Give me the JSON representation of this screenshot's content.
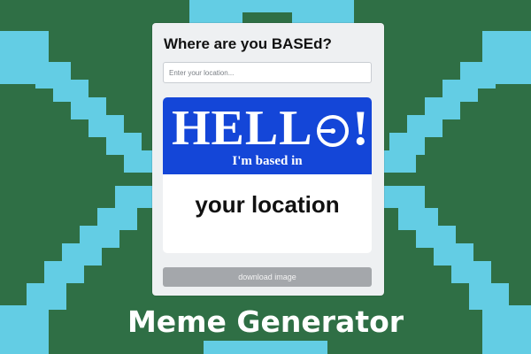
{
  "colors": {
    "background": "#2f6f45",
    "pixel_pattern": "#63cde4",
    "badge_blue": "#1446d8",
    "button_gray": "#a4a7ab"
  },
  "card": {
    "title": "Where are you BASEd?",
    "location_input": {
      "value": "",
      "placeholder": "Enter your location..."
    },
    "badge": {
      "hello_text": "HELL",
      "exclamation": "!",
      "hello_mark_icon": "circle-with-dot-icon",
      "subtitle": "I'm based in",
      "location_text": "your location"
    },
    "download_button_label": "download image"
  },
  "caption": "Meme Generator"
}
